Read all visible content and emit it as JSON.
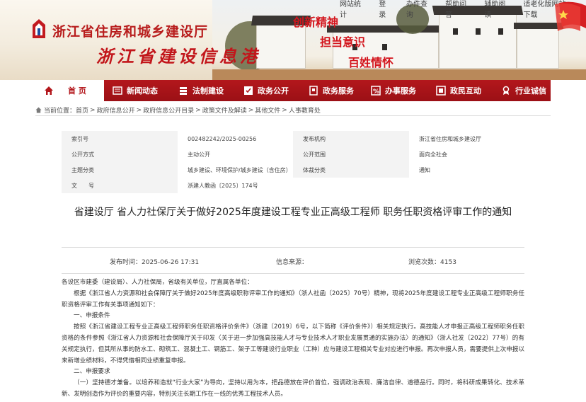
{
  "header": {
    "topnav": [
      "网站统计",
      "登录",
      "办件查询",
      "帮助问答",
      "辅助阅读",
      "适老化版网站下载"
    ],
    "site_name": "浙江省住房和城乡建设厅",
    "slogan": "浙江省建设信息港",
    "mottos": [
      "创新精神",
      "担当意识",
      "百姓情怀"
    ],
    "accent": "#b3171c"
  },
  "nav": {
    "items": [
      {
        "label": "首 页",
        "icon": "home-icon"
      },
      {
        "label": "新闻动态",
        "icon": "news-icon"
      },
      {
        "label": "法制建设",
        "icon": "law-icon"
      },
      {
        "label": "政务公开",
        "icon": "open-gov-icon"
      },
      {
        "label": "政务服务",
        "icon": "service-icon"
      },
      {
        "label": "办事服务",
        "icon": "affairs-icon"
      },
      {
        "label": "政民互动",
        "icon": "interaction-icon"
      },
      {
        "label": "行业诚信",
        "icon": "credit-icon"
      }
    ]
  },
  "breadcrumb": {
    "prefix": "当前位置：",
    "items": [
      "首页",
      "政府信息公开",
      "政府信息公开目录",
      "政策文件及解读",
      "其他文件",
      "人事教育处"
    ]
  },
  "meta": {
    "index_label": "索引号",
    "index_value": "002482242/2025-00256",
    "issuer_label": "发布机构",
    "issuer_value": "浙江省住房和城乡建设厅",
    "mode_label": "公开方式",
    "mode_value": "主动公开",
    "scope_label": "公开范围",
    "scope_value": "面向全社会",
    "topic_label": "主题分类",
    "topic_value": "城乡建设、环境保护/城乡建设（含住房）",
    "genre_label": "体裁分类",
    "genre_value": "通知",
    "docno_label": "文　　号",
    "docno_value": "浙建人教函〔2025〕174号"
  },
  "title": "省建设厅 省人力社保厅关于做好2025年度建设工程专业正高级工程师 职务任职资格评审工作的通知",
  "info": {
    "date_label": "发布时间：",
    "date_value": "2025-06-26 17:31",
    "source_label": "信息来源：",
    "source_value": "",
    "views_label": "浏览次数：",
    "views_value": "4153"
  },
  "body": {
    "p1": "各设区市建委（建设局）、人力社保局，省级有关单位，厅直属各单位：",
    "p2": "根据《浙江省人力资源和社会保障厅关于做好2025年度高级职称评审工作的通知》（浙人社函〔2025〕70号）精神，现将2025年度建设工程专业正高级工程师职务任职资格评审工作有关事项通知如下：",
    "h1": "一、申报条件",
    "p3": "按照《浙江省建设工程专业正高级工程师职务任职资格评价条件》（浙建〔2019〕6号，以下简称《评价条件》）相关规定执行。高技能人才申报正高级工程师职务任职资格的条件参照《浙江省人力资源和社会保障厅关于印发〈关于进一步加强高技能人才与专业技术人才职业发展贯通的实施办法〉的通知》（浙人社发〔2022〕77号）的有关规定执行，但其所从事的防水工、砌筑工、混凝土工、钢筋工、架子工等建设行业职业（工种）应与建设工程相关专业对应进行申报。再次申报人员，需要提供上次申报以来新增业绩材料，不得凭借相同业绩重复申报。",
    "h2": "二、申报要求",
    "p4": "（一）坚持德才兼备。以培养和造就“行业大家”为导向，坚持以用为本，把品德放在评价首位，强调政治表现、廉洁自律、道德品行。同时，将科研成果转化、技术革新、发明创造作为评价的重要内容，特别关注长期工作在一线的优秀工程技术人员。"
  }
}
